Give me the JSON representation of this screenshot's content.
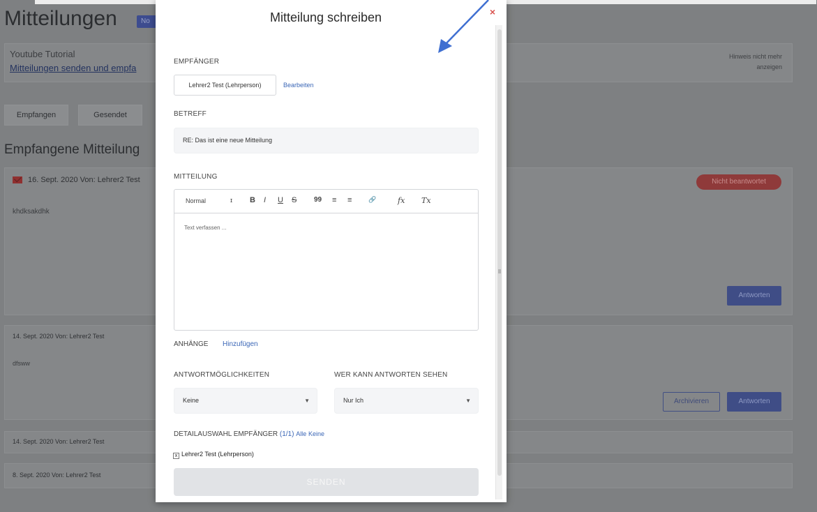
{
  "background": {
    "page_title": "Mitteilungen",
    "title_badge": "No",
    "tutorial": {
      "label": "Youtube Tutorial",
      "link": "Mitteilungen senden und empfa"
    },
    "hint": "Hinweis nicht mehr anzeigen",
    "tabs": [
      "Empfangen",
      "Gesendet"
    ],
    "section_title": "Empfangene Mitteilung",
    "messages": [
      {
        "header": "16. Sept. 2020   Von: Lehrer2 Test",
        "body": "khdksakdhk",
        "status": "Nicht beantwortet",
        "actions": [
          "Antworten"
        ]
      },
      {
        "header": "14. Sept. 2020   Von: Lehrer2 Test",
        "body": "dfsww",
        "actions": [
          "Archivieren",
          "Antworten"
        ]
      },
      {
        "header": "14. Sept. 2020   Von: Lehrer2 Test"
      },
      {
        "header": "8. Sept. 2020   Von: Lehrer2 Test"
      }
    ]
  },
  "modal": {
    "title": "Mitteilung schreiben",
    "close_symbol": "×",
    "recipient_label": "EMPFÄNGER",
    "recipient_chip": "Lehrer2 Test (Lehrperson)",
    "edit_link": "Bearbeiten",
    "subject_label": "BETREFF",
    "subject_value": "RE: Das ist eine neue Mitteilung",
    "message_label": "MITTEILUNG",
    "toolbar": {
      "format": "Normal",
      "size": "ɪ",
      "bold": "B",
      "italic": "I",
      "underline": "U",
      "strike": "S",
      "quote": "99",
      "ordered_list": "≡",
      "bullet_list": "≡",
      "link": "🔗",
      "formula": "fx",
      "clear": "Tx"
    },
    "editor_placeholder": "Text verfassen ...",
    "attachments_label": "ANHÄNGE",
    "attachments_link": "Hinzufügen",
    "reply_options_label": "ANTWORTMÖGLICHKEITEN",
    "reply_options_value": "Keine",
    "visibility_label": "WER KANN ANTWORTEN SEHEN",
    "visibility_value": "Nur Ich",
    "detail_label": "DETAILAUSWAHL EMPFÄNGER",
    "detail_count": "(1/1)",
    "detail_all": "Alle",
    "detail_none": "Keine",
    "detail_checkbox_mark": "x",
    "detail_recipient": "Lehrer2 Test (Lehrperson)",
    "send_button": "SENDEN"
  },
  "colors": {
    "link": "#3a66b6",
    "close": "#d9534f",
    "arrow": "#3f6fd1"
  }
}
